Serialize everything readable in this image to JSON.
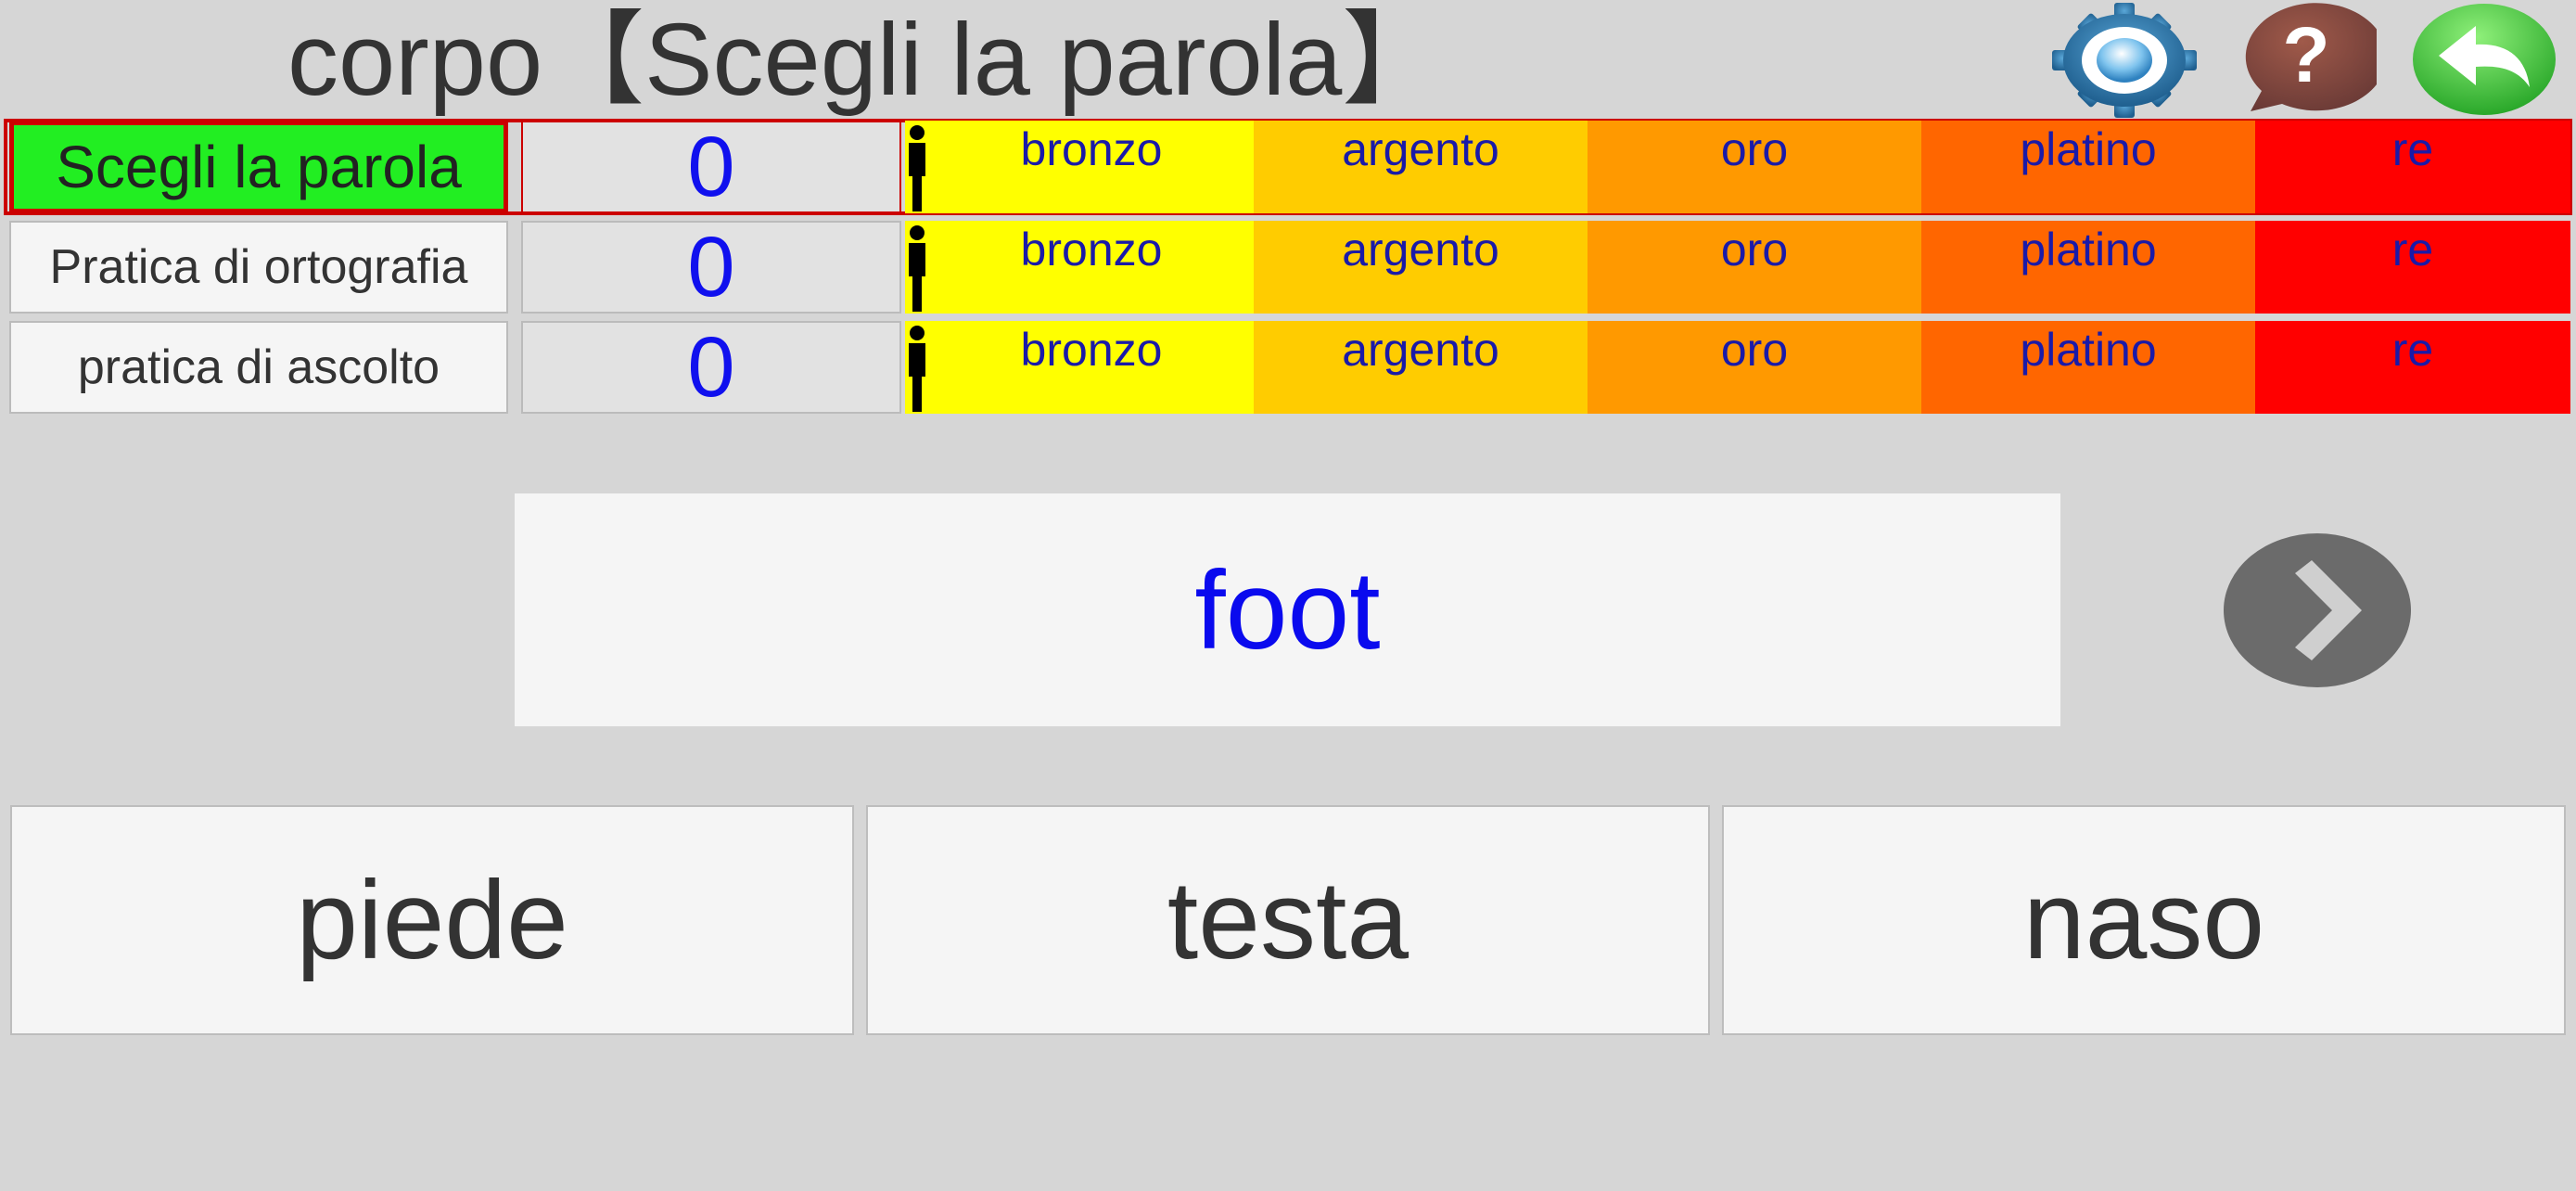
{
  "header": {
    "title": "corpo【Scegli la parola】",
    "icons": [
      "gear-icon",
      "help-icon",
      "back-arrow-icon"
    ]
  },
  "ranks": [
    {
      "label": "bronzo",
      "color": "#ffff00"
    },
    {
      "label": "argento",
      "color": "#ffcc00"
    },
    {
      "label": "oro",
      "color": "#ff9900"
    },
    {
      "label": "platino",
      "color": "#ff6600"
    },
    {
      "label": "re",
      "color": "#ff0000"
    }
  ],
  "modes": [
    {
      "label": "Scegli la parola",
      "score": "0",
      "active": true
    },
    {
      "label": "Pratica di ortografia",
      "score": "0",
      "active": false
    },
    {
      "label": "pratica di ascolto",
      "score": "0",
      "active": false
    }
  ],
  "question": {
    "word": "foot"
  },
  "answers": [
    "piede",
    "testa",
    "naso"
  ],
  "colors": {
    "background": "#d6d6d6",
    "active_mode": "#22ee22",
    "active_border": "#cc0000",
    "score_text": "#1010ee",
    "prompt_text": "#0a0aee",
    "rank_text": "#1a1aa8"
  }
}
